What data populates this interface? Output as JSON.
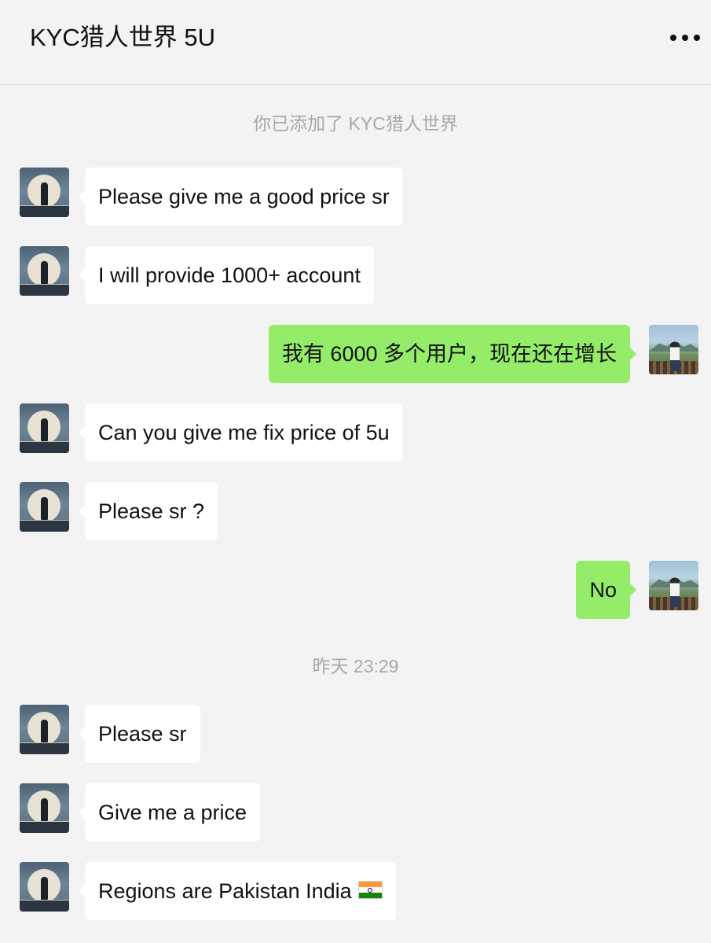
{
  "header": {
    "title": "KYC猎人世界 5U",
    "more_icon": "more-dots-icon"
  },
  "system_messages": {
    "added_notice": "你已添加了 KYC猎人世界",
    "timestamp": "昨天 23:29"
  },
  "messages": [
    {
      "side": "left",
      "text": "Please give me a good price sr"
    },
    {
      "side": "left",
      "text": "I will provide 1000+ account"
    },
    {
      "side": "right",
      "text": "我有 6000 多个用户，现在还在增长"
    },
    {
      "side": "left",
      "text": "Can you give me fix price of 5u"
    },
    {
      "side": "left",
      "text": "Please sr ?"
    },
    {
      "side": "right",
      "text": "No"
    },
    {
      "side": "left",
      "text": "Please sr"
    },
    {
      "side": "left",
      "text": "Give me a price"
    },
    {
      "side": "left",
      "text": "Regions are Pakistan India",
      "emoji": "india-flag-icon"
    }
  ],
  "colors": {
    "background": "#f3f3f3",
    "incoming_bubble": "#ffffff",
    "outgoing_bubble": "#95ec69",
    "system_text": "#a8a8a8"
  }
}
